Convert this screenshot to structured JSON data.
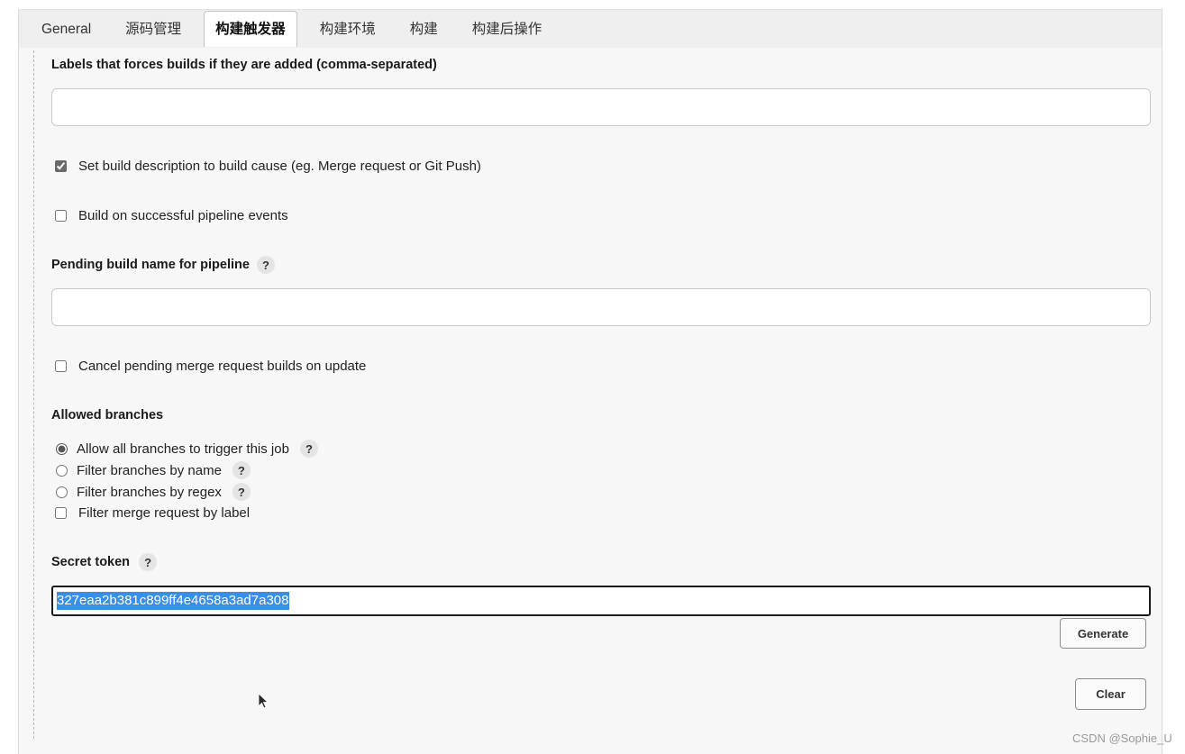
{
  "tabs": [
    {
      "label": "General",
      "active": false
    },
    {
      "label": "源码管理",
      "active": false
    },
    {
      "label": "构建触发器",
      "active": true
    },
    {
      "label": "构建环境",
      "active": false
    },
    {
      "label": "构建",
      "active": false
    },
    {
      "label": "构建后操作",
      "active": false
    }
  ],
  "help_glyph": "?",
  "triggers": {
    "labels_force_builds": {
      "label": "Labels that forces builds if they are added (comma-separated)",
      "value": ""
    },
    "set_build_description": {
      "label": "Set build description to build cause (eg. Merge request or Git Push)",
      "checked": true
    },
    "build_on_pipeline_events": {
      "label": "Build on successful pipeline events",
      "checked": false
    },
    "pending_build_name": {
      "label": "Pending build name for pipeline",
      "value": ""
    },
    "cancel_pending_builds": {
      "label": "Cancel pending merge request builds on update",
      "checked": false
    },
    "allowed_branches": {
      "label": "Allowed branches",
      "options": [
        {
          "label": "Allow all branches to trigger this job",
          "selected": true
        },
        {
          "label": "Filter branches by name",
          "selected": false
        },
        {
          "label": "Filter branches by regex",
          "selected": false
        }
      ],
      "filter_by_label": {
        "label": "Filter merge request by label",
        "checked": false
      }
    },
    "secret_token": {
      "label": "Secret token",
      "value": "327eaa2b381c899ff4e4658a3ad7a308",
      "text_selected": true
    },
    "generate_button": "Generate",
    "clear_button": "Clear"
  },
  "watermark": "CSDN @Sophie_U"
}
